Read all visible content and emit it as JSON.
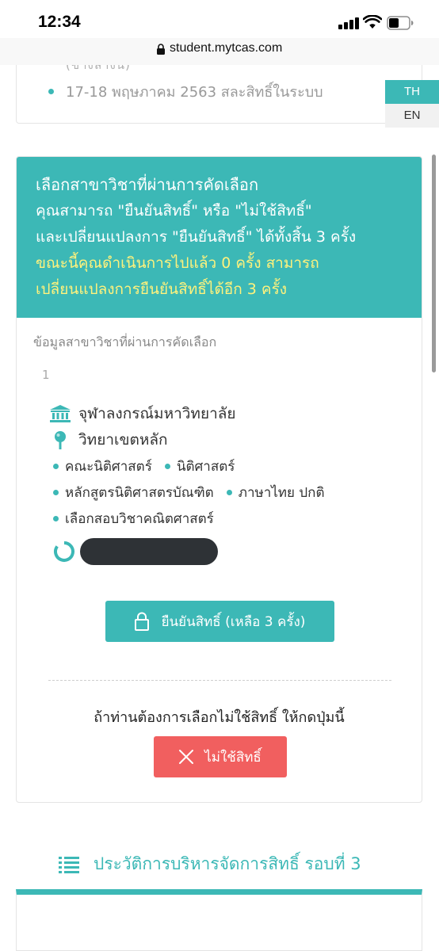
{
  "status_bar": {
    "time": "12:34"
  },
  "browser": {
    "url": "student.mytcas.com"
  },
  "top_card": {
    "cut_text": "(ข้างล่างนี้)",
    "bullet": "17-18 พฤษภาคม 2563 สละสิทธิ์ในระบบ"
  },
  "language": {
    "th": "TH",
    "en": "EN"
  },
  "main_card": {
    "header": {
      "title": "เลือกสาขาวิชาที่ผ่านการคัดเลือก",
      "line1": "คุณสามารถ \"ยืนยันสิทธิ์\" หรือ \"ไม่ใช้สิทธิ์\"",
      "line2": "และเปลี่ยนแปลงการ \"ยืนยันสิทธิ์\" ได้ทั้งสิ้น 3 ครั้ง",
      "line3": "ขณะนี้คุณดำเนินการไปแล้ว 0 ครั้ง สามารถ",
      "line4": "เปลี่ยนแปลงการยืนยันสิทธิ์ได้อีก 3 ครั้ง"
    },
    "section_label": "ข้อมูลสาขาวิชาที่ผ่านการคัดเลือก",
    "item_number": "1",
    "university": "จุฬาลงกรณ์มหาวิทยาลัย",
    "campus": "วิทยาเขตหลัก",
    "faculty": "คณะนิติศาสตร์",
    "department": "นิติศาสตร์",
    "program": "หลักสูตรนิติศาสตรบัณฑิต",
    "language_track": "ภาษาไทย ปกติ",
    "subject_option": "เลือกสอบวิชาคณิตศาสตร์",
    "confirm_button": "ยืนยันสิทธิ์ (เหลือ 3 ครั้ง)",
    "decline_prompt": "ถ้าท่านต้องการเลือกไม่ใช้สิทธิ์ ให้กดปุ่มนี้",
    "decline_button": "ไม่ใช้สิทธิ์"
  },
  "history": {
    "title": "ประวัติการบริหารจัดการสิทธิ์ รอบที่ 3"
  },
  "colors": {
    "accent": "#3cb8b6",
    "danger": "#f15f5f",
    "highlight": "#fff27c"
  },
  "icons": [
    "signal-icon",
    "wifi-icon",
    "battery-icon",
    "lock-icon",
    "university-icon",
    "location-pin-icon",
    "loading-spinner-icon",
    "close-icon",
    "list-icon"
  ]
}
